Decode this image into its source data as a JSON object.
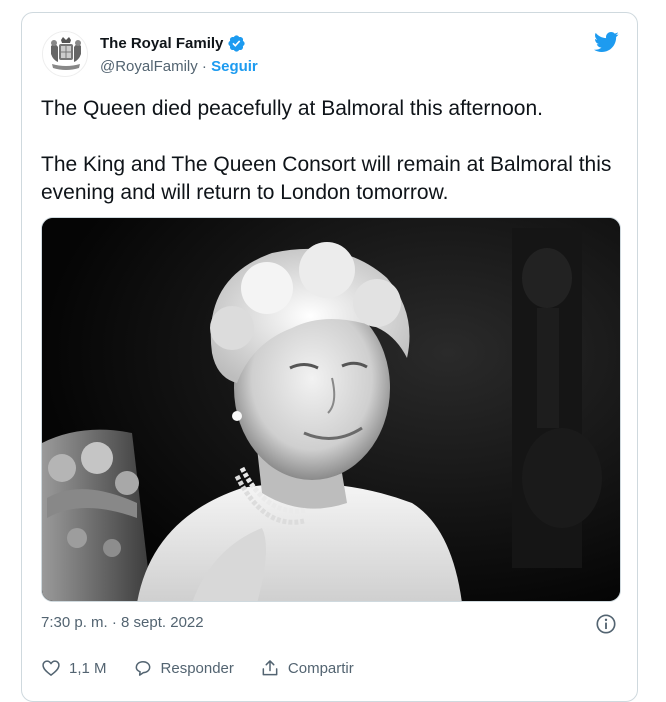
{
  "tweet": {
    "author_name": "The Royal Family",
    "handle": "@RoyalFamily",
    "separator": " · ",
    "follow_label": "Seguir",
    "text_paragraphs": [
      "The Queen died peacefully at Balmoral this afternoon.",
      "The King and The Queen Consort will remain at Balmoral this evening and will return to London tomorrow."
    ],
    "timestamp": "7:30 p. m. · 8 sept. 2022",
    "actions": {
      "likes_count": "1,1 M",
      "reply_label": "Responder",
      "share_label": "Compartir"
    }
  },
  "icons": {
    "verified": "verified-badge-icon",
    "brand": "twitter-bird-icon",
    "info": "info-icon",
    "like": "heart-icon",
    "reply": "speech-bubble-icon",
    "share": "share-upload-icon"
  },
  "colors": {
    "accent": "#1d9bf0",
    "text": "#0f1419",
    "secondary_text": "#536471",
    "border": "#cfd9de"
  }
}
